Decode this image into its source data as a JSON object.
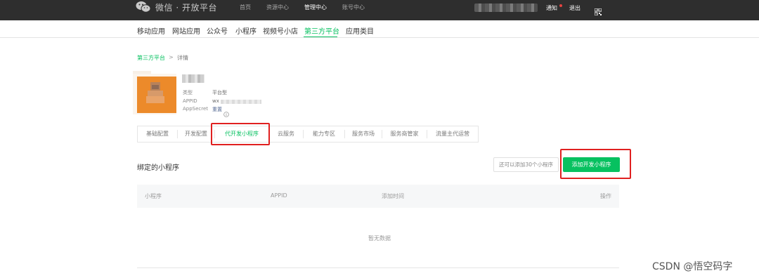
{
  "header": {
    "logo_text": "微信 · 开放平台",
    "nav": [
      {
        "label": "首页",
        "active": false
      },
      {
        "label": "资源中心",
        "active": false
      },
      {
        "label": "管理中心",
        "active": true
      },
      {
        "label": "账号中心",
        "active": false
      }
    ],
    "notify_label": "通知",
    "logout_label": "退出"
  },
  "subnav": {
    "items": [
      {
        "label": "移动应用",
        "active": false
      },
      {
        "label": "网站应用",
        "active": false
      },
      {
        "label": "公众号",
        "active": false
      },
      {
        "label": "小程序",
        "active": false
      },
      {
        "label": "视频号小店",
        "active": false
      },
      {
        "label": "第三方平台",
        "active": true
      },
      {
        "label": "应用类目",
        "active": false
      }
    ]
  },
  "breadcrumb": {
    "parent": "第三方平台",
    "separator": ">",
    "current": "详情"
  },
  "app": {
    "type_label": "类型",
    "type_value": "平台型",
    "appid_label": "APPID",
    "appid_value": "wx",
    "secret_label": "AppSecret",
    "secret_action": "重置"
  },
  "tabs": [
    {
      "label": "基础配置",
      "active": false
    },
    {
      "label": "开发配置",
      "active": false
    },
    {
      "label": "代开发小程序",
      "active": true
    },
    {
      "label": "云服务",
      "active": false
    },
    {
      "label": "能力专区",
      "active": false
    },
    {
      "label": "服务市场",
      "active": false
    },
    {
      "label": "服务商管家",
      "active": false
    },
    {
      "label": "流量主代运营",
      "active": false
    }
  ],
  "section": {
    "title": "绑定的小程序",
    "quota_text": "还可以添加30个小程序",
    "add_button": "添加开发小程序"
  },
  "table": {
    "columns": [
      "小程序",
      "APPID",
      "添加时间",
      "操作"
    ],
    "rows": [],
    "empty_text": "暂无数据"
  },
  "watermark": "CSDN @悟空码字",
  "colors": {
    "accent": "#07c160",
    "highlight": "#e02020",
    "topbar": "#2e2e2e"
  }
}
